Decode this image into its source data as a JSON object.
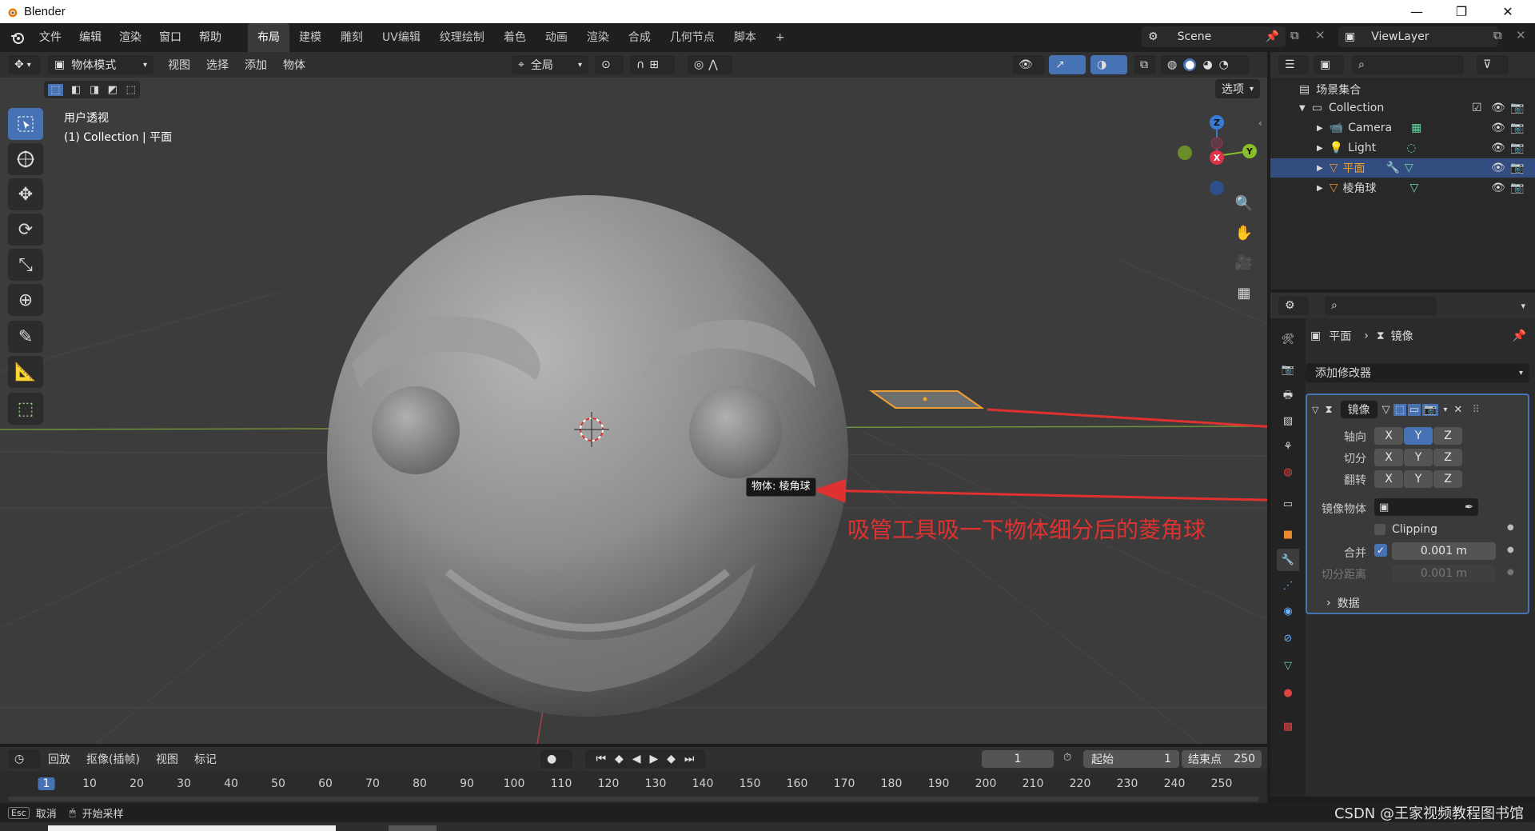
{
  "window": {
    "title": "Blender",
    "btn_min": "—",
    "btn_max": "❐",
    "btn_close": "✕"
  },
  "menubar": {
    "items": [
      "文件",
      "编辑",
      "渲染",
      "窗口",
      "帮助"
    ],
    "workspaces": [
      "布局",
      "建模",
      "雕刻",
      "UV编辑",
      "纹理绘制",
      "着色",
      "动画",
      "渲染",
      "合成",
      "几何节点",
      "脚本"
    ],
    "active_workspace": "布局",
    "add_tab": "+",
    "scene": "Scene",
    "viewlayer": "ViewLayer"
  },
  "viewport": {
    "mode": "物体模式",
    "menus": [
      "视图",
      "选择",
      "添加",
      "物体"
    ],
    "transform_orientation": "全局",
    "options_label": "选项",
    "overlay_title": "用户透视",
    "overlay_subtitle": "(1) Collection | 平面",
    "tooltip": "物体: 棱角球",
    "annotation": "吸管工具吸一下物体细分后的菱角球",
    "gizmo": {
      "x": "X",
      "y": "Y",
      "z": "Z"
    },
    "colors": {
      "accent": "#4772b3",
      "arrow": "#e03131",
      "selected": "#f0a030"
    }
  },
  "outliner": {
    "root": "场景集合",
    "collection": "Collection",
    "items": [
      {
        "name": "Camera",
        "type": "camera"
      },
      {
        "name": "Light",
        "type": "light"
      },
      {
        "name": "平面",
        "type": "mesh",
        "selected": true
      },
      {
        "name": "棱角球",
        "type": "mesh"
      }
    ]
  },
  "properties": {
    "breadcrumb_object": "平面",
    "breadcrumb_modifier": "镜像",
    "add_modifier": "添加修改器",
    "modifier_name": "镜像",
    "axis_label": "轴向",
    "bisect_label": "切分",
    "flip_label": "翻转",
    "axes": [
      "X",
      "Y",
      "Z"
    ],
    "active_axis": "Y",
    "mirror_object_label": "镜像物体",
    "clipping_label": "Clipping",
    "merge_label": "合并",
    "merge_value": "0.001 m",
    "bisect_distance_label": "切分距离",
    "bisect_distance_value": "0.001 m",
    "data_label": "数据"
  },
  "timeline": {
    "menus": [
      "回放",
      "抠像(插帧)",
      "视图",
      "标记"
    ],
    "current_frame": "1",
    "start_label": "起始",
    "start_value": "1",
    "end_label": "结束点",
    "end_value": "250",
    "frames": [
      "1",
      "10",
      "20",
      "30",
      "40",
      "50",
      "60",
      "70",
      "80",
      "90",
      "100",
      "110",
      "120",
      "130",
      "140",
      "150",
      "160",
      "170",
      "180",
      "190",
      "200",
      "210",
      "220",
      "230",
      "240",
      "250"
    ]
  },
  "statusbar": {
    "esc_key": "Esc",
    "cancel": "取消",
    "start_sampling": "开始采样",
    "watermark": "CSDN @王家视频教程图书馆"
  }
}
